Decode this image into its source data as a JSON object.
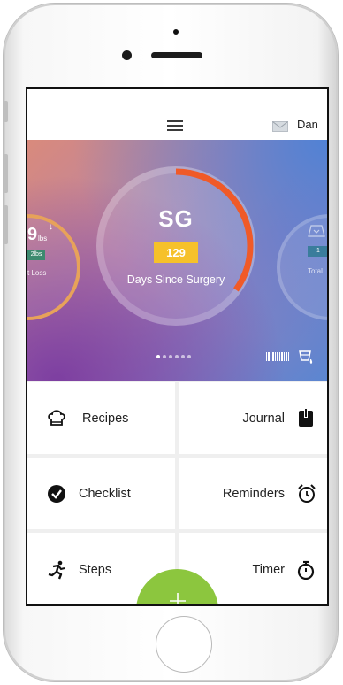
{
  "header": {
    "user_name": "Dan",
    "menu_icon": "hamburger-menu-icon",
    "message_icon": "mail-icon"
  },
  "carousel": {
    "main": {
      "title": "SG",
      "value": "129",
      "caption": "Days Since Surgery",
      "ring_color": "#f05a28",
      "badge_color": "#f6c12a",
      "progress": 0.35
    },
    "left_peek": {
      "value": "9",
      "unit": "lbs",
      "badge": "2lbs",
      "caption": "t Loss",
      "ring_color": "#e7a25a"
    },
    "right_peek": {
      "badge": "1",
      "caption": "Total",
      "icon": "scale-icon"
    },
    "page_count": 6,
    "active_index": 0,
    "tools": {
      "barcode_icon": "barcode-icon",
      "dispense_icon": "dispense-icon"
    }
  },
  "tiles": [
    {
      "label": "Recipes",
      "icon": "chef-hat-icon"
    },
    {
      "label": "Journal",
      "icon": "journal-icon"
    },
    {
      "label": "Checklist",
      "icon": "check-circle-icon"
    },
    {
      "label": "Reminders",
      "icon": "alarm-clock-icon"
    },
    {
      "label": "Steps",
      "icon": "runner-icon"
    },
    {
      "label": "Timer",
      "icon": "stopwatch-icon"
    }
  ],
  "fab": {
    "icon": "plus-icon",
    "color": "#8cc63e"
  }
}
